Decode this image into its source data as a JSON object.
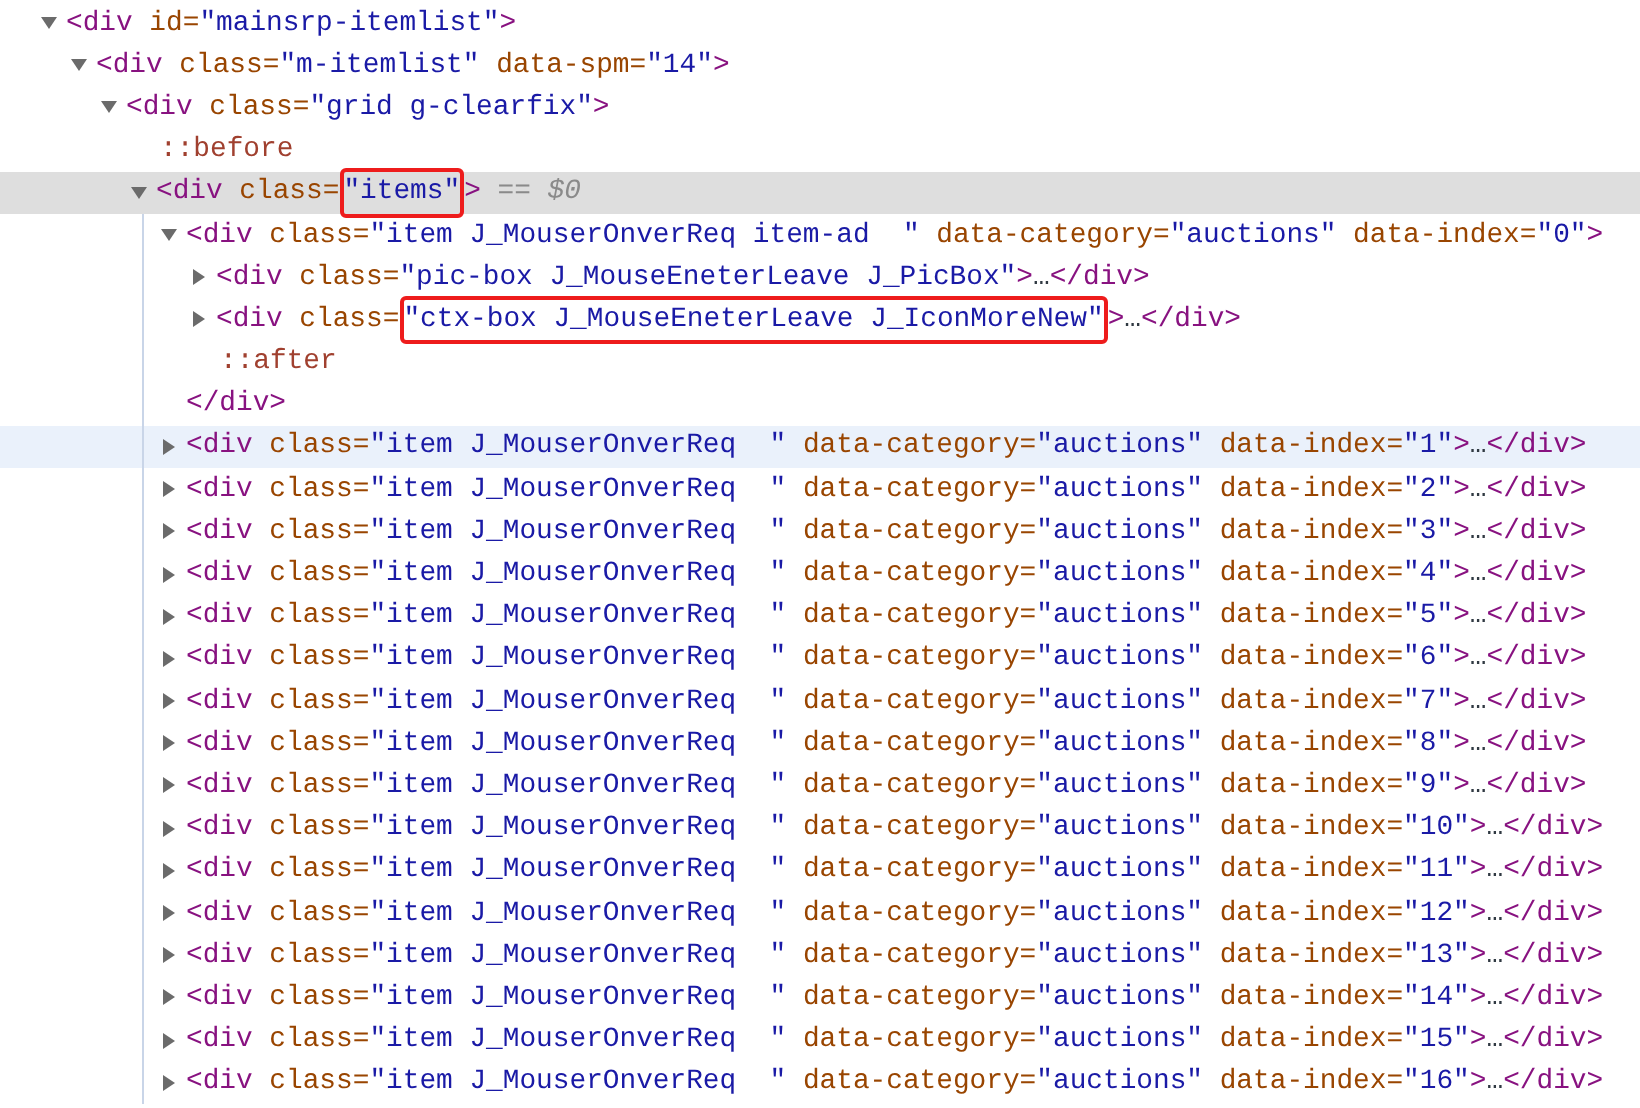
{
  "tree": [
    {
      "kind": "element",
      "expanded": true,
      "selected": false,
      "hovered": false,
      "tokens": [
        {
          "kind": "tag",
          "t": "<div"
        },
        {
          "kind": "attr",
          "t": " id="
        },
        {
          "kind": "value",
          "t": "\"mainsrp-itemlist\""
        },
        {
          "kind": "tag",
          "t": ">"
        }
      ],
      "children": [
        {
          "kind": "element",
          "expanded": true,
          "selected": false,
          "hovered": false,
          "tokens": [
            {
              "kind": "tag",
              "t": "<div"
            },
            {
              "kind": "attr",
              "t": " class="
            },
            {
              "kind": "value",
              "t": "\"m-itemlist\""
            },
            {
              "kind": "attr",
              "t": " data-spm="
            },
            {
              "kind": "value",
              "t": "\"14\""
            },
            {
              "kind": "tag",
              "t": ">"
            }
          ],
          "children": [
            {
              "kind": "element",
              "expanded": true,
              "selected": false,
              "hovered": false,
              "tokens": [
                {
                  "kind": "tag",
                  "t": "<div"
                },
                {
                  "kind": "attr",
                  "t": " class="
                },
                {
                  "kind": "value",
                  "t": "\"grid g-clearfix\""
                },
                {
                  "kind": "tag",
                  "t": ">"
                }
              ],
              "children": [
                {
                  "kind": "pseudo",
                  "selected": false,
                  "hovered": false,
                  "tokens": [
                    {
                      "kind": "pseudo",
                      "t": "::before"
                    }
                  ]
                },
                {
                  "kind": "element",
                  "expanded": true,
                  "selected": true,
                  "hovered": false,
                  "tokens": [
                    {
                      "kind": "tag",
                      "t": "<div"
                    },
                    {
                      "kind": "attr",
                      "t": " class="
                    },
                    {
                      "kind": "value",
                      "t": "\"items\"",
                      "highlighted": true
                    },
                    {
                      "kind": "tag",
                      "t": ">"
                    },
                    {
                      "kind": "console",
                      "t": " == $0"
                    }
                  ],
                  "children": [
                    {
                      "kind": "element",
                      "expanded": true,
                      "selected": false,
                      "hovered": false,
                      "tokens": [
                        {
                          "kind": "tag",
                          "t": "<div"
                        },
                        {
                          "kind": "attr",
                          "t": " class="
                        },
                        {
                          "kind": "value",
                          "t": "\"item J_MouserOnverReq item-ad  \""
                        },
                        {
                          "kind": "attr",
                          "t": " data-category="
                        },
                        {
                          "kind": "value",
                          "t": "\"auctions\""
                        },
                        {
                          "kind": "attr",
                          "t": " data-index="
                        },
                        {
                          "kind": "value",
                          "t": "\"0\""
                        },
                        {
                          "kind": "tag",
                          "t": ">"
                        }
                      ],
                      "children": [
                        {
                          "kind": "element",
                          "expanded": false,
                          "selected": false,
                          "hovered": false,
                          "tokens": [
                            {
                              "kind": "tag",
                              "t": "<div"
                            },
                            {
                              "kind": "attr",
                              "t": " class="
                            },
                            {
                              "kind": "value",
                              "t": "\"pic-box J_MouseEneterLeave J_PicBox\""
                            },
                            {
                              "kind": "tag",
                              "t": ">"
                            },
                            {
                              "kind": "text",
                              "t": "…"
                            },
                            {
                              "kind": "tag",
                              "t": "</div>"
                            }
                          ]
                        },
                        {
                          "kind": "element",
                          "expanded": false,
                          "selected": false,
                          "hovered": false,
                          "tokens": [
                            {
                              "kind": "tag",
                              "t": "<div"
                            },
                            {
                              "kind": "attr",
                              "t": " class="
                            },
                            {
                              "kind": "value",
                              "t": "\"ctx-box J_MouseEneterLeave J_IconMoreNew\"",
                              "highlighted": true
                            },
                            {
                              "kind": "tag",
                              "t": ">"
                            },
                            {
                              "kind": "text",
                              "t": "…"
                            },
                            {
                              "kind": "tag",
                              "t": "</div>"
                            }
                          ]
                        },
                        {
                          "kind": "pseudo",
                          "selected": false,
                          "hovered": false,
                          "tokens": [
                            {
                              "kind": "pseudo",
                              "t": "::after"
                            }
                          ]
                        }
                      ],
                      "closing": [
                        {
                          "kind": "tag",
                          "t": "</div>"
                        }
                      ]
                    },
                    {
                      "kind": "element",
                      "expanded": false,
                      "selected": false,
                      "hovered": true,
                      "tokens": [
                        {
                          "kind": "tag",
                          "t": "<div"
                        },
                        {
                          "kind": "attr",
                          "t": " class="
                        },
                        {
                          "kind": "value",
                          "t": "\"item J_MouserOnverReq  \""
                        },
                        {
                          "kind": "attr",
                          "t": " data-category="
                        },
                        {
                          "kind": "value",
                          "t": "\"auctions\""
                        },
                        {
                          "kind": "attr",
                          "t": " data-index="
                        },
                        {
                          "kind": "value",
                          "t": "\"1\""
                        },
                        {
                          "kind": "tag",
                          "t": ">"
                        },
                        {
                          "kind": "text",
                          "t": "…"
                        },
                        {
                          "kind": "tag",
                          "t": "</div>"
                        }
                      ]
                    },
                    {
                      "kind": "element",
                      "expanded": false,
                      "selected": false,
                      "hovered": false,
                      "tokens": [
                        {
                          "kind": "tag",
                          "t": "<div"
                        },
                        {
                          "kind": "attr",
                          "t": " class="
                        },
                        {
                          "kind": "value",
                          "t": "\"item J_MouserOnverReq  \""
                        },
                        {
                          "kind": "attr",
                          "t": " data-category="
                        },
                        {
                          "kind": "value",
                          "t": "\"auctions\""
                        },
                        {
                          "kind": "attr",
                          "t": " data-index="
                        },
                        {
                          "kind": "value",
                          "t": "\"2\""
                        },
                        {
                          "kind": "tag",
                          "t": ">"
                        },
                        {
                          "kind": "text",
                          "t": "…"
                        },
                        {
                          "kind": "tag",
                          "t": "</div>"
                        }
                      ]
                    },
                    {
                      "kind": "element",
                      "expanded": false,
                      "selected": false,
                      "hovered": false,
                      "tokens": [
                        {
                          "kind": "tag",
                          "t": "<div"
                        },
                        {
                          "kind": "attr",
                          "t": " class="
                        },
                        {
                          "kind": "value",
                          "t": "\"item J_MouserOnverReq  \""
                        },
                        {
                          "kind": "attr",
                          "t": " data-category="
                        },
                        {
                          "kind": "value",
                          "t": "\"auctions\""
                        },
                        {
                          "kind": "attr",
                          "t": " data-index="
                        },
                        {
                          "kind": "value",
                          "t": "\"3\""
                        },
                        {
                          "kind": "tag",
                          "t": ">"
                        },
                        {
                          "kind": "text",
                          "t": "…"
                        },
                        {
                          "kind": "tag",
                          "t": "</div>"
                        }
                      ]
                    },
                    {
                      "kind": "element",
                      "expanded": false,
                      "selected": false,
                      "hovered": false,
                      "tokens": [
                        {
                          "kind": "tag",
                          "t": "<div"
                        },
                        {
                          "kind": "attr",
                          "t": " class="
                        },
                        {
                          "kind": "value",
                          "t": "\"item J_MouserOnverReq  \""
                        },
                        {
                          "kind": "attr",
                          "t": " data-category="
                        },
                        {
                          "kind": "value",
                          "t": "\"auctions\""
                        },
                        {
                          "kind": "attr",
                          "t": " data-index="
                        },
                        {
                          "kind": "value",
                          "t": "\"4\""
                        },
                        {
                          "kind": "tag",
                          "t": ">"
                        },
                        {
                          "kind": "text",
                          "t": "…"
                        },
                        {
                          "kind": "tag",
                          "t": "</div>"
                        }
                      ]
                    },
                    {
                      "kind": "element",
                      "expanded": false,
                      "selected": false,
                      "hovered": false,
                      "tokens": [
                        {
                          "kind": "tag",
                          "t": "<div"
                        },
                        {
                          "kind": "attr",
                          "t": " class="
                        },
                        {
                          "kind": "value",
                          "t": "\"item J_MouserOnverReq  \""
                        },
                        {
                          "kind": "attr",
                          "t": " data-category="
                        },
                        {
                          "kind": "value",
                          "t": "\"auctions\""
                        },
                        {
                          "kind": "attr",
                          "t": " data-index="
                        },
                        {
                          "kind": "value",
                          "t": "\"5\""
                        },
                        {
                          "kind": "tag",
                          "t": ">"
                        },
                        {
                          "kind": "text",
                          "t": "…"
                        },
                        {
                          "kind": "tag",
                          "t": "</div>"
                        }
                      ]
                    },
                    {
                      "kind": "element",
                      "expanded": false,
                      "selected": false,
                      "hovered": false,
                      "tokens": [
                        {
                          "kind": "tag",
                          "t": "<div"
                        },
                        {
                          "kind": "attr",
                          "t": " class="
                        },
                        {
                          "kind": "value",
                          "t": "\"item J_MouserOnverReq  \""
                        },
                        {
                          "kind": "attr",
                          "t": " data-category="
                        },
                        {
                          "kind": "value",
                          "t": "\"auctions\""
                        },
                        {
                          "kind": "attr",
                          "t": " data-index="
                        },
                        {
                          "kind": "value",
                          "t": "\"6\""
                        },
                        {
                          "kind": "tag",
                          "t": ">"
                        },
                        {
                          "kind": "text",
                          "t": "…"
                        },
                        {
                          "kind": "tag",
                          "t": "</div>"
                        }
                      ]
                    },
                    {
                      "kind": "element",
                      "expanded": false,
                      "selected": false,
                      "hovered": false,
                      "tokens": [
                        {
                          "kind": "tag",
                          "t": "<div"
                        },
                        {
                          "kind": "attr",
                          "t": " class="
                        },
                        {
                          "kind": "value",
                          "t": "\"item J_MouserOnverReq  \""
                        },
                        {
                          "kind": "attr",
                          "t": " data-category="
                        },
                        {
                          "kind": "value",
                          "t": "\"auctions\""
                        },
                        {
                          "kind": "attr",
                          "t": " data-index="
                        },
                        {
                          "kind": "value",
                          "t": "\"7\""
                        },
                        {
                          "kind": "tag",
                          "t": ">"
                        },
                        {
                          "kind": "text",
                          "t": "…"
                        },
                        {
                          "kind": "tag",
                          "t": "</div>"
                        }
                      ]
                    },
                    {
                      "kind": "element",
                      "expanded": false,
                      "selected": false,
                      "hovered": false,
                      "tokens": [
                        {
                          "kind": "tag",
                          "t": "<div"
                        },
                        {
                          "kind": "attr",
                          "t": " class="
                        },
                        {
                          "kind": "value",
                          "t": "\"item J_MouserOnverReq  \""
                        },
                        {
                          "kind": "attr",
                          "t": " data-category="
                        },
                        {
                          "kind": "value",
                          "t": "\"auctions\""
                        },
                        {
                          "kind": "attr",
                          "t": " data-index="
                        },
                        {
                          "kind": "value",
                          "t": "\"8\""
                        },
                        {
                          "kind": "tag",
                          "t": ">"
                        },
                        {
                          "kind": "text",
                          "t": "…"
                        },
                        {
                          "kind": "tag",
                          "t": "</div>"
                        }
                      ]
                    },
                    {
                      "kind": "element",
                      "expanded": false,
                      "selected": false,
                      "hovered": false,
                      "tokens": [
                        {
                          "kind": "tag",
                          "t": "<div"
                        },
                        {
                          "kind": "attr",
                          "t": " class="
                        },
                        {
                          "kind": "value",
                          "t": "\"item J_MouserOnverReq  \""
                        },
                        {
                          "kind": "attr",
                          "t": " data-category="
                        },
                        {
                          "kind": "value",
                          "t": "\"auctions\""
                        },
                        {
                          "kind": "attr",
                          "t": " data-index="
                        },
                        {
                          "kind": "value",
                          "t": "\"9\""
                        },
                        {
                          "kind": "tag",
                          "t": ">"
                        },
                        {
                          "kind": "text",
                          "t": "…"
                        },
                        {
                          "kind": "tag",
                          "t": "</div>"
                        }
                      ]
                    },
                    {
                      "kind": "element",
                      "expanded": false,
                      "selected": false,
                      "hovered": false,
                      "tokens": [
                        {
                          "kind": "tag",
                          "t": "<div"
                        },
                        {
                          "kind": "attr",
                          "t": " class="
                        },
                        {
                          "kind": "value",
                          "t": "\"item J_MouserOnverReq  \""
                        },
                        {
                          "kind": "attr",
                          "t": " data-category="
                        },
                        {
                          "kind": "value",
                          "t": "\"auctions\""
                        },
                        {
                          "kind": "attr",
                          "t": " data-index="
                        },
                        {
                          "kind": "value",
                          "t": "\"10\""
                        },
                        {
                          "kind": "tag",
                          "t": ">"
                        },
                        {
                          "kind": "text",
                          "t": "…"
                        },
                        {
                          "kind": "tag",
                          "t": "</div>"
                        }
                      ]
                    },
                    {
                      "kind": "element",
                      "expanded": false,
                      "selected": false,
                      "hovered": false,
                      "tokens": [
                        {
                          "kind": "tag",
                          "t": "<div"
                        },
                        {
                          "kind": "attr",
                          "t": " class="
                        },
                        {
                          "kind": "value",
                          "t": "\"item J_MouserOnverReq  \""
                        },
                        {
                          "kind": "attr",
                          "t": " data-category="
                        },
                        {
                          "kind": "value",
                          "t": "\"auctions\""
                        },
                        {
                          "kind": "attr",
                          "t": " data-index="
                        },
                        {
                          "kind": "value",
                          "t": "\"11\""
                        },
                        {
                          "kind": "tag",
                          "t": ">"
                        },
                        {
                          "kind": "text",
                          "t": "…"
                        },
                        {
                          "kind": "tag",
                          "t": "</div>"
                        }
                      ]
                    },
                    {
                      "kind": "element",
                      "expanded": false,
                      "selected": false,
                      "hovered": false,
                      "tokens": [
                        {
                          "kind": "tag",
                          "t": "<div"
                        },
                        {
                          "kind": "attr",
                          "t": " class="
                        },
                        {
                          "kind": "value",
                          "t": "\"item J_MouserOnverReq  \""
                        },
                        {
                          "kind": "attr",
                          "t": " data-category="
                        },
                        {
                          "kind": "value",
                          "t": "\"auctions\""
                        },
                        {
                          "kind": "attr",
                          "t": " data-index="
                        },
                        {
                          "kind": "value",
                          "t": "\"12\""
                        },
                        {
                          "kind": "tag",
                          "t": ">"
                        },
                        {
                          "kind": "text",
                          "t": "…"
                        },
                        {
                          "kind": "tag",
                          "t": "</div>"
                        }
                      ]
                    },
                    {
                      "kind": "element",
                      "expanded": false,
                      "selected": false,
                      "hovered": false,
                      "tokens": [
                        {
                          "kind": "tag",
                          "t": "<div"
                        },
                        {
                          "kind": "attr",
                          "t": " class="
                        },
                        {
                          "kind": "value",
                          "t": "\"item J_MouserOnverReq  \""
                        },
                        {
                          "kind": "attr",
                          "t": " data-category="
                        },
                        {
                          "kind": "value",
                          "t": "\"auctions\""
                        },
                        {
                          "kind": "attr",
                          "t": " data-index="
                        },
                        {
                          "kind": "value",
                          "t": "\"13\""
                        },
                        {
                          "kind": "tag",
                          "t": ">"
                        },
                        {
                          "kind": "text",
                          "t": "…"
                        },
                        {
                          "kind": "tag",
                          "t": "</div>"
                        }
                      ]
                    },
                    {
                      "kind": "element",
                      "expanded": false,
                      "selected": false,
                      "hovered": false,
                      "tokens": [
                        {
                          "kind": "tag",
                          "t": "<div"
                        },
                        {
                          "kind": "attr",
                          "t": " class="
                        },
                        {
                          "kind": "value",
                          "t": "\"item J_MouserOnverReq  \""
                        },
                        {
                          "kind": "attr",
                          "t": " data-category="
                        },
                        {
                          "kind": "value",
                          "t": "\"auctions\""
                        },
                        {
                          "kind": "attr",
                          "t": " data-index="
                        },
                        {
                          "kind": "value",
                          "t": "\"14\""
                        },
                        {
                          "kind": "tag",
                          "t": ">"
                        },
                        {
                          "kind": "text",
                          "t": "…"
                        },
                        {
                          "kind": "tag",
                          "t": "</div>"
                        }
                      ]
                    },
                    {
                      "kind": "element",
                      "expanded": false,
                      "selected": false,
                      "hovered": false,
                      "tokens": [
                        {
                          "kind": "tag",
                          "t": "<div"
                        },
                        {
                          "kind": "attr",
                          "t": " class="
                        },
                        {
                          "kind": "value",
                          "t": "\"item J_MouserOnverReq  \""
                        },
                        {
                          "kind": "attr",
                          "t": " data-category="
                        },
                        {
                          "kind": "value",
                          "t": "\"auctions\""
                        },
                        {
                          "kind": "attr",
                          "t": " data-index="
                        },
                        {
                          "kind": "value",
                          "t": "\"15\""
                        },
                        {
                          "kind": "tag",
                          "t": ">"
                        },
                        {
                          "kind": "text",
                          "t": "…"
                        },
                        {
                          "kind": "tag",
                          "t": "</div>"
                        }
                      ]
                    },
                    {
                      "kind": "element",
                      "expanded": false,
                      "selected": false,
                      "hovered": false,
                      "tokens": [
                        {
                          "kind": "tag",
                          "t": "<div"
                        },
                        {
                          "kind": "attr",
                          "t": " class="
                        },
                        {
                          "kind": "value",
                          "t": "\"item J_MouserOnverReq  \""
                        },
                        {
                          "kind": "attr",
                          "t": " data-category="
                        },
                        {
                          "kind": "value",
                          "t": "\"auctions\""
                        },
                        {
                          "kind": "attr",
                          "t": " data-index="
                        },
                        {
                          "kind": "value",
                          "t": "\"16\""
                        },
                        {
                          "kind": "tag",
                          "t": ">"
                        },
                        {
                          "kind": "text",
                          "t": "…"
                        },
                        {
                          "kind": "tag",
                          "t": "</div>"
                        }
                      ]
                    }
                  ]
                }
              ]
            }
          ]
        }
      ]
    }
  ]
}
